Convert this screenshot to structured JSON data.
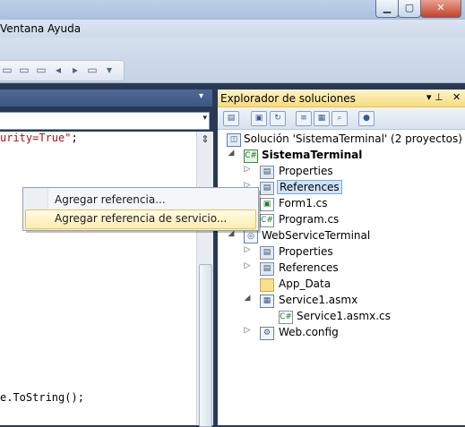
{
  "window": {
    "min_label": "▁",
    "max_label": "▢",
    "close_label": "✕"
  },
  "menu": [
    "Ventana",
    "Ayuda"
  ],
  "editor": {
    "code_line1_red": "urity=True\"",
    "code_line1_rest": ";",
    "code_line2": "e.ToString();",
    "pin_label": "▾",
    "combo_arrow": "▾"
  },
  "solution_explorer": {
    "title": "Explorador de soluciones",
    "pin_label": "▾ ⊥",
    "close_label": "✕",
    "tree": [
      {
        "label": "Solución 'SistemaTerminal'  (2 proyectos)",
        "icon": "solution-icon"
      },
      {
        "label": "SistemaTerminal",
        "icon": "csharp-project-icon",
        "bold": true
      },
      {
        "label": "Properties",
        "icon": "properties-icon"
      },
      {
        "label": "References",
        "icon": "references-icon"
      },
      {
        "label": "Form1.cs",
        "icon": "form-icon"
      },
      {
        "label": "Program.cs",
        "icon": "csharp-file-icon"
      },
      {
        "label": "WebServiceTerminal",
        "icon": "web-project-icon"
      },
      {
        "label": "Properties",
        "icon": "properties-icon"
      },
      {
        "label": "References",
        "icon": "references-icon"
      },
      {
        "label": "App_Data",
        "icon": "folder-icon"
      },
      {
        "label": "Service1.asmx",
        "icon": "asmx-file-icon"
      },
      {
        "label": "Service1.asmx.cs",
        "icon": "csharp-file-icon"
      },
      {
        "label": "Web.config",
        "icon": "config-file-icon"
      }
    ]
  },
  "context_menu": {
    "items": [
      "Agregar referencia...",
      "Agregar referencia de servicio..."
    ]
  }
}
